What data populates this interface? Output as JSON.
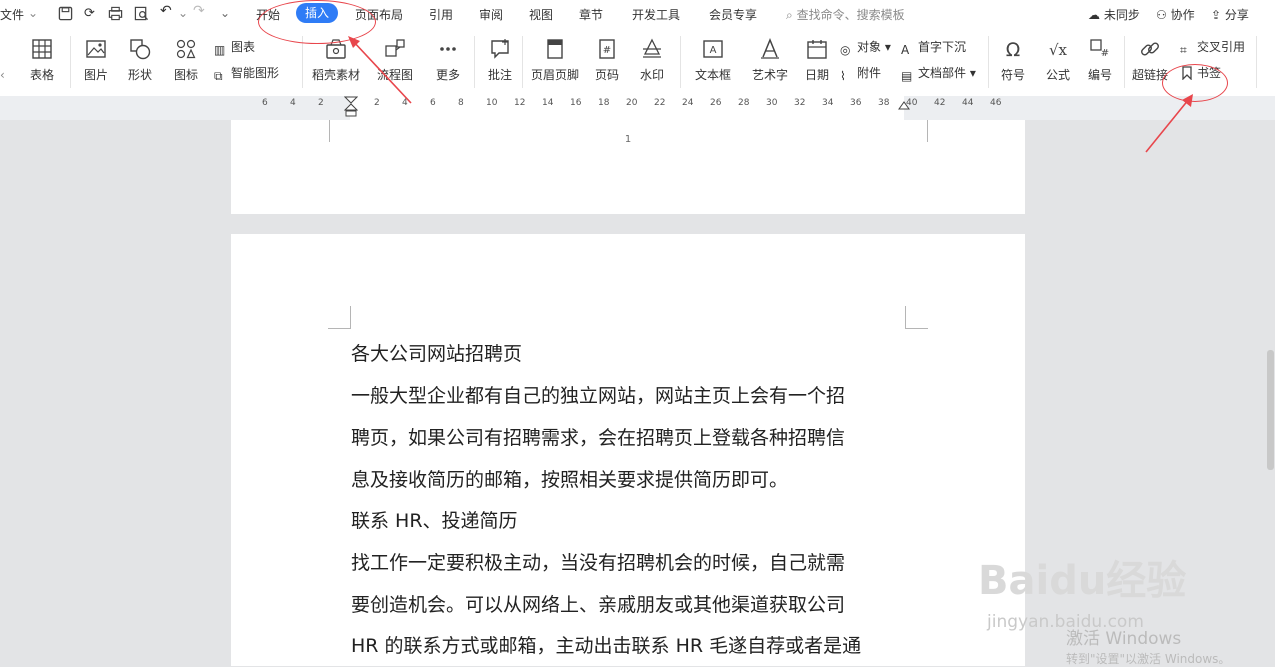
{
  "menubar": {
    "file": "文件",
    "tabs": [
      "开始",
      "插入",
      "页面布局",
      "引用",
      "审阅",
      "视图",
      "章节",
      "开发工具",
      "会员专享"
    ],
    "active_tab": "插入",
    "search_placeholder": "查找命令、搜索模板",
    "right": {
      "sync": "未同步",
      "collab": "协作",
      "share": "分享"
    }
  },
  "toolbar": {
    "table": "表格",
    "picture": "图片",
    "shape": "形状",
    "icon": "图标",
    "chart": "图表",
    "smart_graphic": "智能图形",
    "daoke": "稻壳素材",
    "flowchart": "流程图",
    "more": "更多",
    "comment": "批注",
    "header_footer": "页眉页脚",
    "page_number": "页码",
    "watermark": "水印",
    "textbox": "文本框",
    "wordart": "艺术字",
    "date": "日期",
    "object": "对象",
    "attachment": "附件",
    "dropcap": "首字下沉",
    "doc_parts": "文档部件",
    "symbol": "符号",
    "formula": "公式",
    "numbering": "编号",
    "hyperlink": "超链接",
    "cross_ref": "交叉引用",
    "bookmark": "书签"
  },
  "ruler_labels": [
    "6",
    "4",
    "2",
    "2",
    "4",
    "6",
    "8",
    "10",
    "12",
    "14",
    "16",
    "18",
    "20",
    "22",
    "24",
    "26",
    "28",
    "30",
    "32",
    "34",
    "36",
    "38",
    "40",
    "42",
    "44",
    "46"
  ],
  "page1": {
    "page_number": "1"
  },
  "document": {
    "lines": [
      "各大公司网站招聘页",
      "一般大型企业都有自己的独立网站，网站主页上会有一个招",
      "聘页，如果公司有招聘需求，会在招聘页上登载各种招聘信",
      "息及接收简历的邮箱，按照相关要求提供简历即可。",
      "联系 HR、投递简历",
      "找工作一定要积极主动，当没有招聘机会的时候，自己就需",
      "要创造机会。可以从网络上、亲戚朋友或其他渠道获取公司",
      "HR 的联系方式或邮箱，主动出击联系 HR 毛遂自荐或者是通"
    ]
  },
  "watermark": {
    "brand": "Baidu经验",
    "url": "jingyan.baidu.com"
  },
  "activation": {
    "title": "激活 Windows",
    "subtitle": "转到\"设置\"以激活 Windows。"
  },
  "colors": {
    "accent": "#2f7cf6",
    "annotation": "#e8464c"
  }
}
